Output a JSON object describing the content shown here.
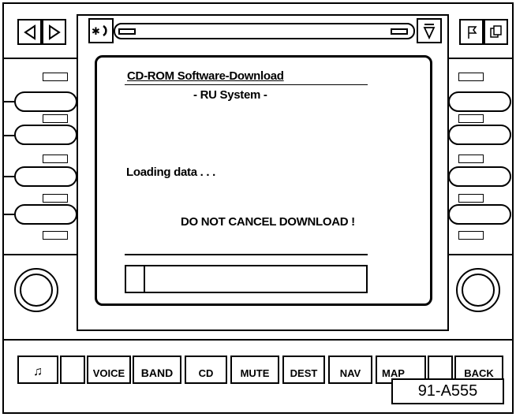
{
  "top_left_buttons": [
    {
      "name": "left-arrow-icon"
    },
    {
      "name": "right-arrow-icon"
    }
  ],
  "top_right_buttons": [
    {
      "name": "flag-icon"
    },
    {
      "name": "pages-icon"
    }
  ],
  "screen": {
    "title": "CD-ROM  Software-Download",
    "subtitle": "- RU System -",
    "status": "Loading data . . .",
    "warning": "DO NOT CANCEL DOWNLOAD !"
  },
  "bottom_buttons": [
    "♫",
    "",
    "VOICE",
    "BAND",
    "CD",
    "MUTE",
    "DEST",
    "NAV",
    "MAP",
    "",
    "BACK"
  ],
  "figure_label": "91-A555"
}
